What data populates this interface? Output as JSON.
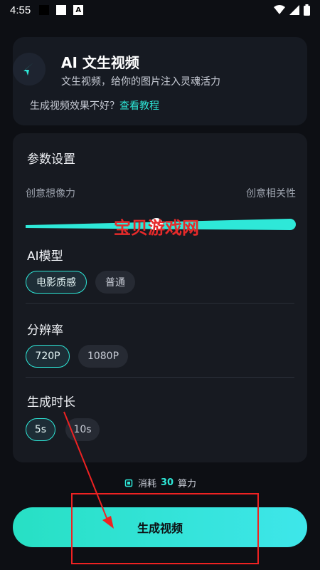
{
  "status_bar": {
    "time": "4:55",
    "a_badge": "A"
  },
  "header": {
    "title": "AI 文生视频",
    "subtitle": "文生视频，给你的图片注入灵魂活力",
    "tip_text": "生成视频效果不好？",
    "tip_link": "查看教程"
  },
  "params": {
    "title": "参数设置",
    "slider": {
      "left_label": "创意想像力",
      "right_label": "创意相关性"
    },
    "model": {
      "title": "AI模型",
      "options": [
        "电影质感",
        "普通"
      ],
      "selected": "电影质感"
    },
    "resolution": {
      "title": "分辨率",
      "options": [
        "720P",
        "1080P"
      ],
      "selected": "720P"
    },
    "duration": {
      "title": "生成时长",
      "options": [
        "5s",
        "10s"
      ],
      "selected": "5s"
    }
  },
  "cost": {
    "prefix": "消耗",
    "amount": "30",
    "suffix": "算力"
  },
  "generate_button": {
    "label": "生成视频"
  },
  "watermark": "宝贝游戏网",
  "colors": {
    "accent": "#2ee8d8",
    "background": "#0d0f14",
    "card": "#171a21",
    "annotation": "#e22222"
  }
}
